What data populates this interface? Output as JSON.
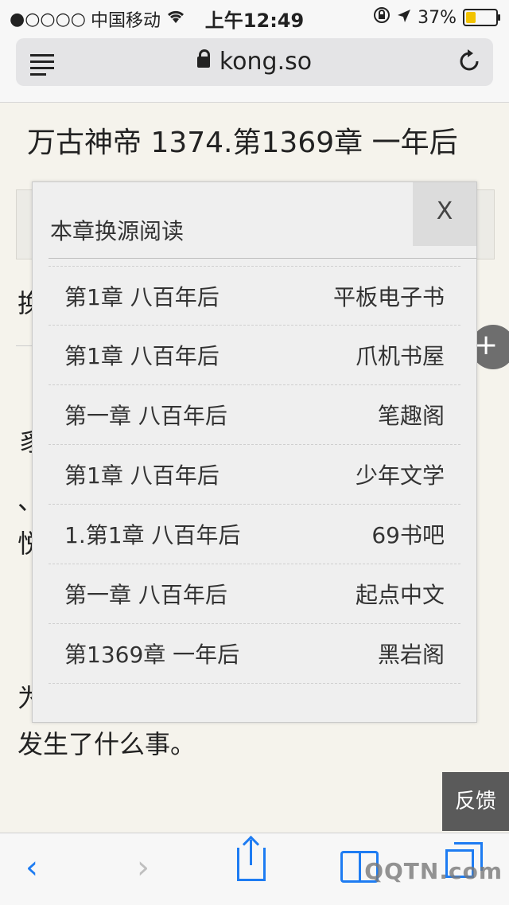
{
  "status_bar": {
    "signal": "●○○○○",
    "carrier": "中国移动",
    "time": "上午12:49",
    "battery_percent": "37%",
    "battery_level": 0.37
  },
  "browser": {
    "url": "kong.so"
  },
  "page": {
    "title": "万古神帝 1374.第1369章 一年后",
    "behind_fragments": [
      "换",
      "豸",
      "、",
      "悦",
      "为"
    ],
    "text_tail": "发生了什么事。",
    "plus_glyph": "+"
  },
  "modal": {
    "title": "本章换源阅读",
    "close_label": "X",
    "sources": [
      {
        "chapter": "第1章 八百年后",
        "site": "平板电子书"
      },
      {
        "chapter": "第1章 八百年后",
        "site": "爪机书屋"
      },
      {
        "chapter": "第一章 八百年后",
        "site": "笔趣阁"
      },
      {
        "chapter": "第1章 八百年后",
        "site": "少年文学"
      },
      {
        "chapter": "1.第1章 八百年后",
        "site": "69书吧"
      },
      {
        "chapter": "第一章 八百年后",
        "site": "起点中文"
      },
      {
        "chapter": "第1369章 一年后",
        "site": "黑岩阁"
      }
    ]
  },
  "feedback_label": "反馈",
  "toolbar": {
    "back_glyph": "‹",
    "forward_glyph": "›"
  },
  "watermark": "QQTN.com",
  "colors": {
    "accent": "#1e7cf2",
    "battery": "#f2c300"
  }
}
